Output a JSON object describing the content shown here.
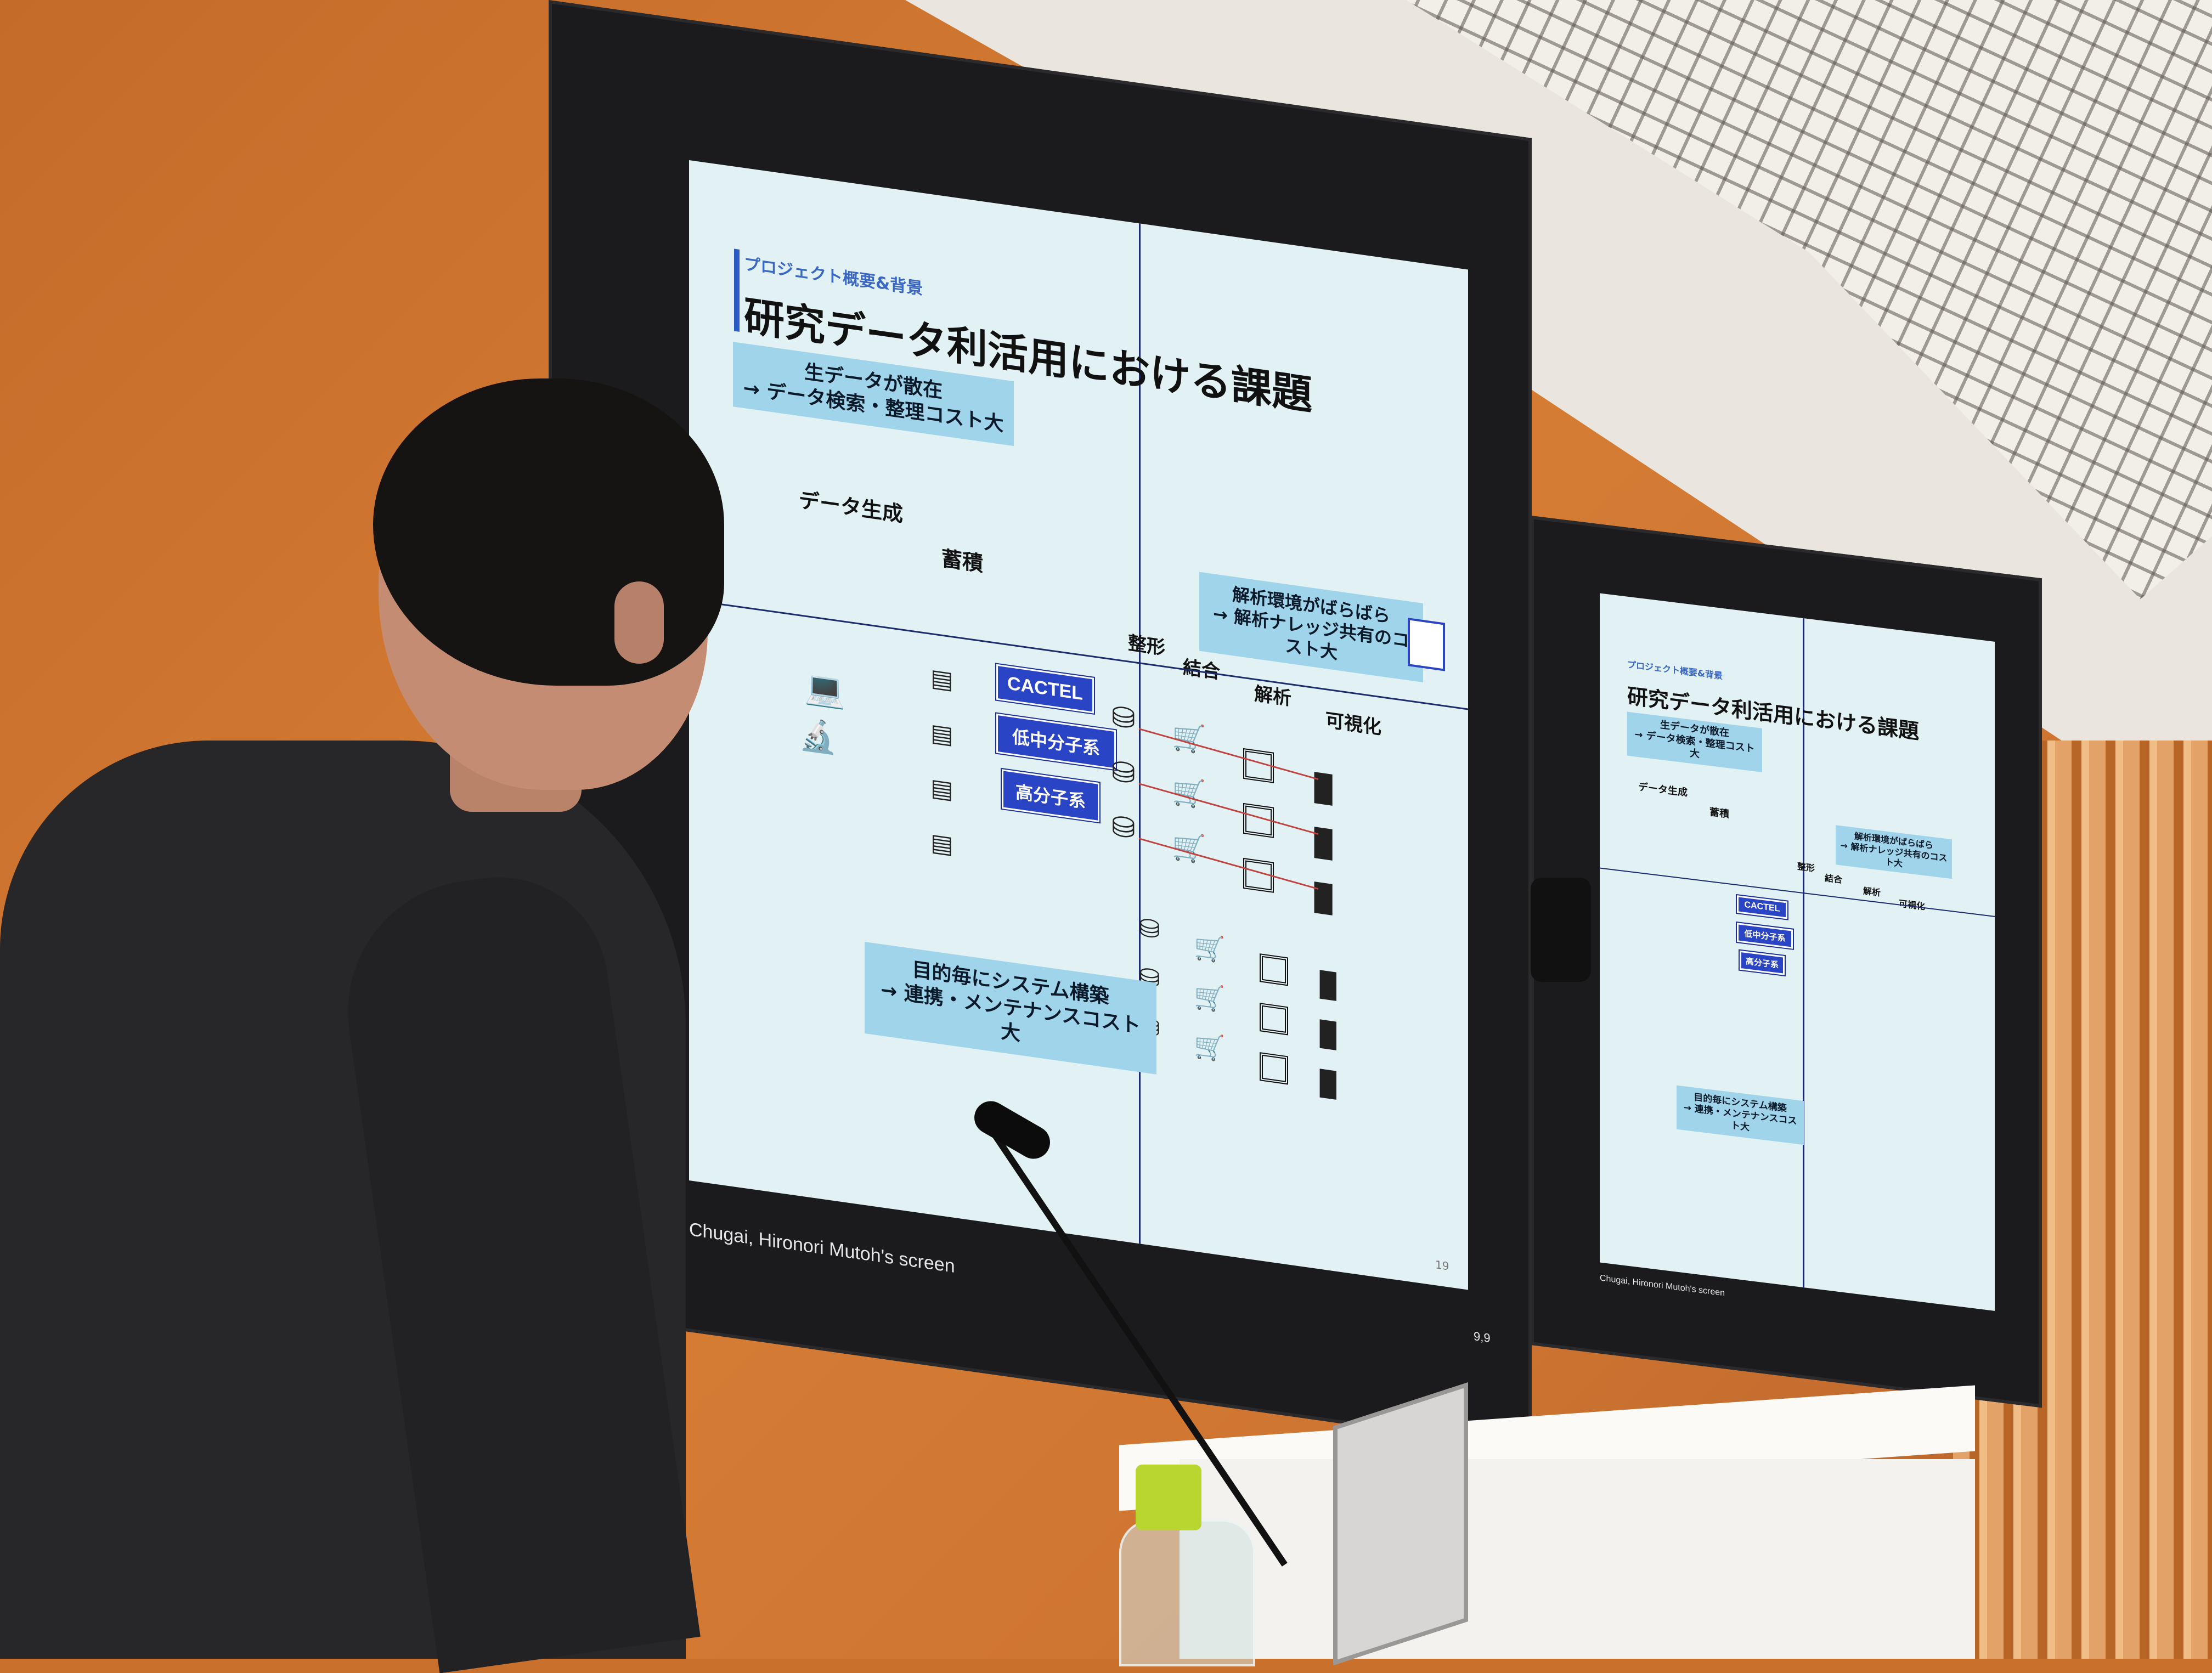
{
  "main_screen": {
    "bezel_label": "Chugai, Hironori Mutoh's screen",
    "corner_label": "9,9",
    "slide": {
      "subtitle": "プロジェクト概要&背景",
      "title": "研究データ利活用における課題",
      "callout_top": [
        "生データが散在",
        "→ データ検索・整理コスト大"
      ],
      "callout_right": [
        "解析環境がばらばら",
        "→ 解析ナレッジ共有のコスト大"
      ],
      "callout_bottom": [
        "目的毎にシステム構築",
        "→ 連携・メンテナンスコスト大"
      ],
      "stage_labels": {
        "generate": "データ生成",
        "store": "蓄積",
        "shape": "整形",
        "join": "結合",
        "analyze": "解析",
        "visualize": "可視化"
      },
      "systems": [
        "CACTEL",
        "低中分子系",
        "高分子系"
      ],
      "page_number": "19"
    }
  },
  "secondary_screen": {
    "bezel_label": "Chugai, Hironori Mutoh's screen",
    "slide": {
      "subtitle": "プロジェクト概要&背景",
      "title": "研究データ利活用における課題",
      "callout_top": [
        "生データが散在",
        "→ データ検索・整理コスト大"
      ],
      "callout_right": [
        "解析環境がばらばら",
        "→ 解析ナレッジ共有のコスト大"
      ],
      "callout_bottom": [
        "目的毎にシステム構築",
        "→ 連携・メンテナンスコスト大"
      ],
      "stage_labels": {
        "generate": "データ生成",
        "store": "蓄積",
        "shape": "整形",
        "join": "結合",
        "analyze": "解析",
        "visualize": "可視化"
      },
      "systems": [
        "CACTEL",
        "低中分子系",
        "高分子系"
      ]
    }
  },
  "icons": {
    "server": "server-icon",
    "database": "database-icon",
    "cart": "cart-icon",
    "chip": "chip-icon",
    "bar_chart": "bar-chart-icon",
    "computer": "computer-icon",
    "microscope": "microscope-icon",
    "logo": "company-logo-icon"
  }
}
